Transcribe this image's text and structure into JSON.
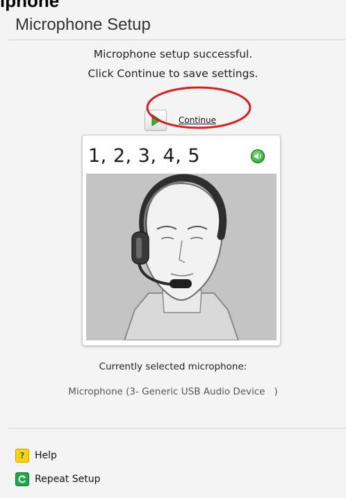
{
  "top_clip_text": "lphone",
  "window": {
    "title": "Microphone Setup"
  },
  "status": {
    "line1": "Microphone setup successful.",
    "line2": "Click Continue to save settings."
  },
  "continue": {
    "label": "Continue"
  },
  "card": {
    "count_text": "1, 2, 3, 4, 5"
  },
  "microphone": {
    "caption": "Currently selected microphone:",
    "name": "Microphone (3- Generic USB Audio Device   )"
  },
  "footer": {
    "help_label": "Help",
    "repeat_label": "Repeat Setup"
  },
  "icons": {
    "continue": "play-arrow-icon",
    "speaker": "speaker-icon",
    "help": "help-icon",
    "repeat": "repeat-icon"
  },
  "colors": {
    "annotation_circle": "#e01b1b",
    "speaker_green": "#1c9a1c",
    "help_yellow": "#ffd400",
    "repeat_green": "#19a84a"
  }
}
